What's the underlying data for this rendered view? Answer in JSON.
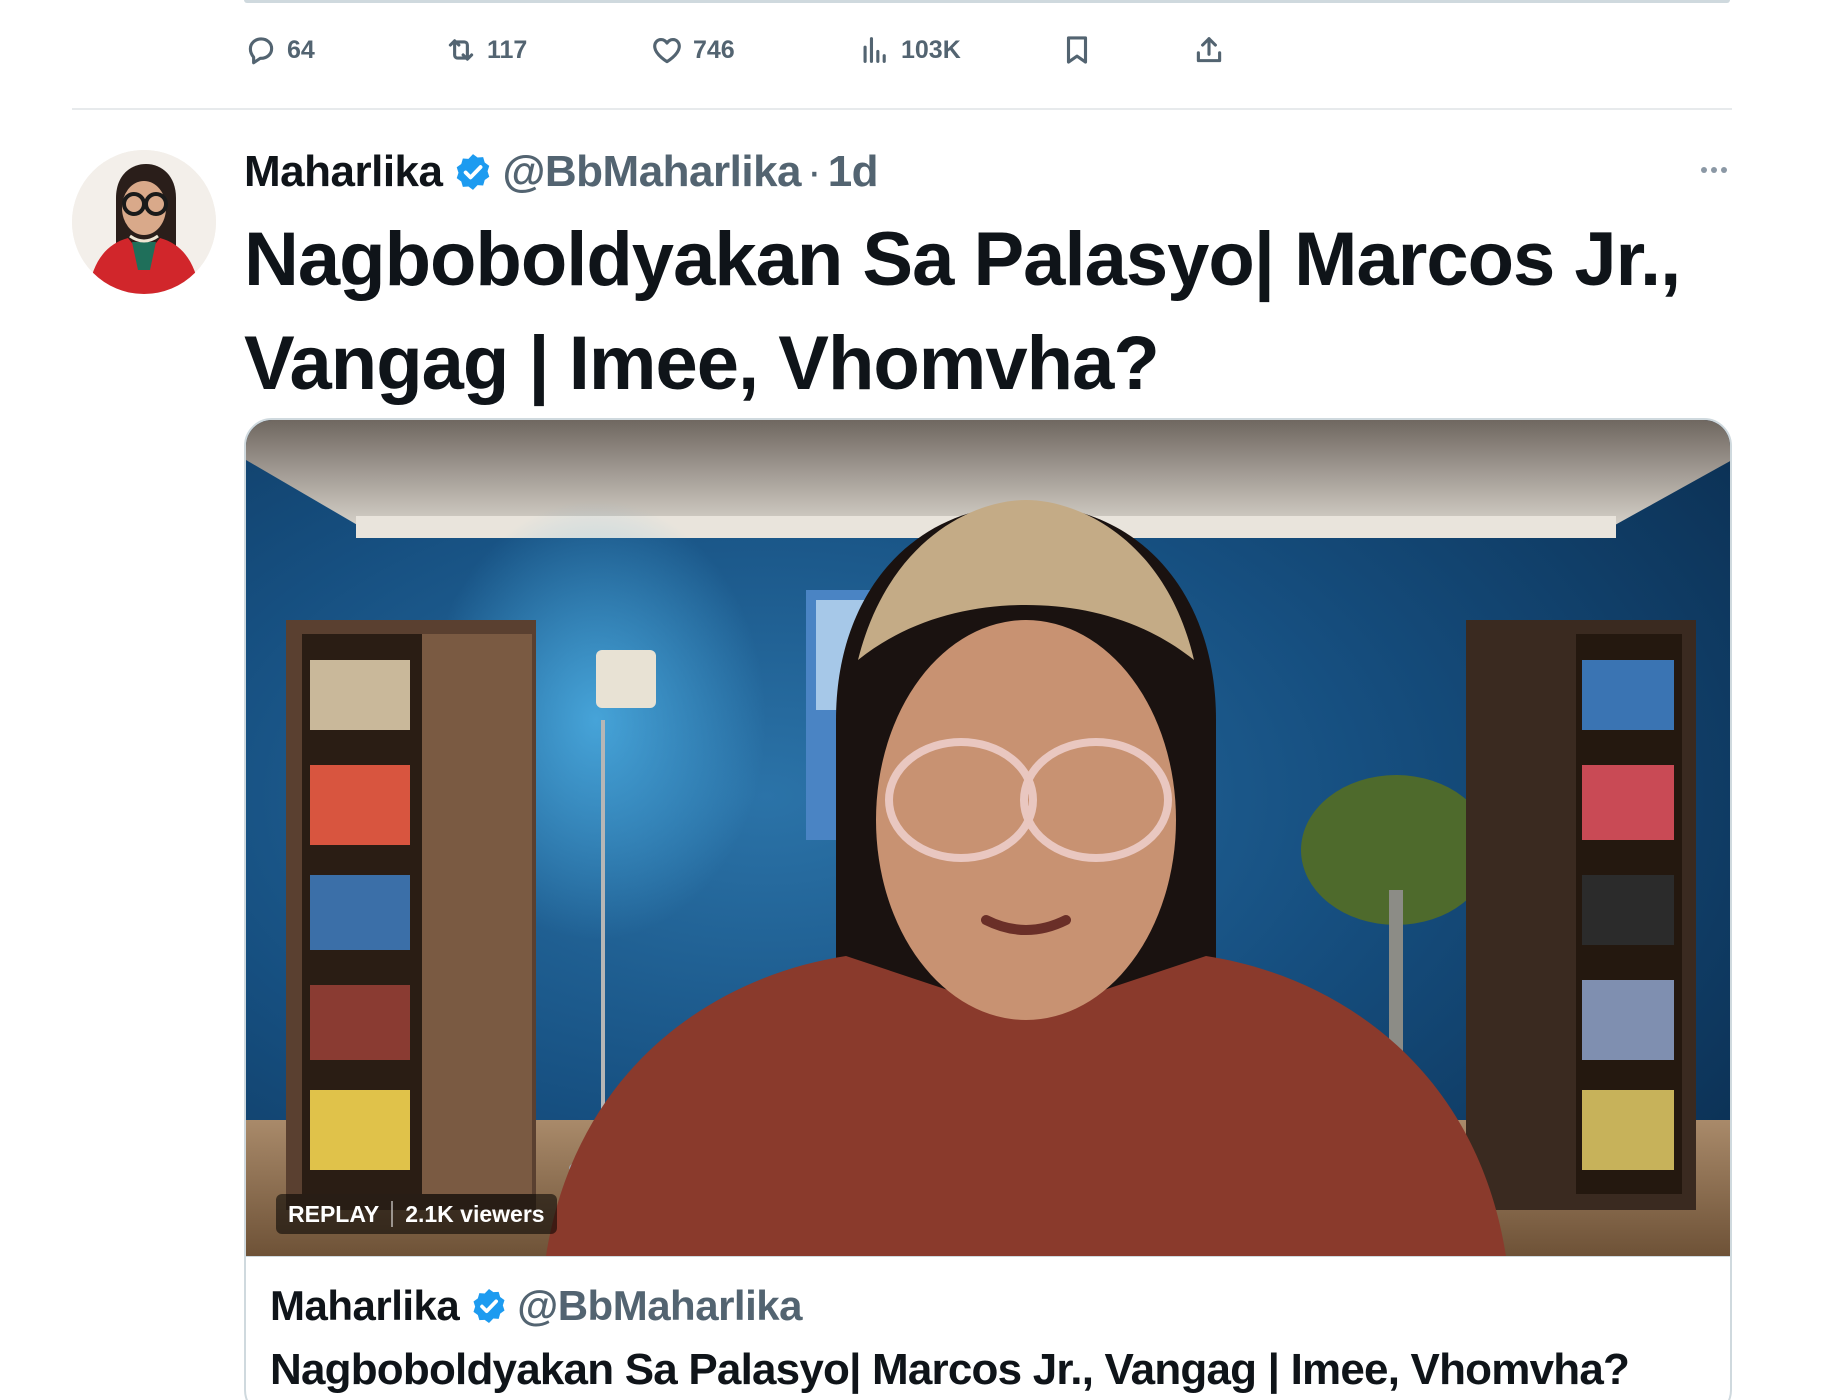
{
  "previous_tweet": {
    "actions": {
      "replies": "64",
      "retweets": "117",
      "likes": "746",
      "views": "103K"
    }
  },
  "tweet": {
    "display_name": "Maharlika",
    "handle": "@BbMaharlika",
    "time": "1d",
    "text": "Nagboboldyakan Sa Palasyo| Marcos Jr., Vangag | Imee, Vhomvha?",
    "card": {
      "badge_status": "REPLAY",
      "badge_viewers": "2.1K viewers",
      "author_name": "Maharlika",
      "author_handle": "@BbMaharlika",
      "title": "Nagboboldyakan Sa Palasyo| Marcos Jr., Vangag | Imee, Vhomvha?"
    }
  },
  "icons": {
    "reply": "reply-icon",
    "retweet": "retweet-icon",
    "like": "heart-icon",
    "views": "views-icon",
    "bookmark": "bookmark-icon",
    "share": "share-icon",
    "verified": "verified-badge-icon",
    "more": "more-icon"
  },
  "colors": {
    "text_primary": "#0f1419",
    "text_secondary": "#536471",
    "verified_blue": "#1d9bf0",
    "border": "#cfd9de"
  }
}
